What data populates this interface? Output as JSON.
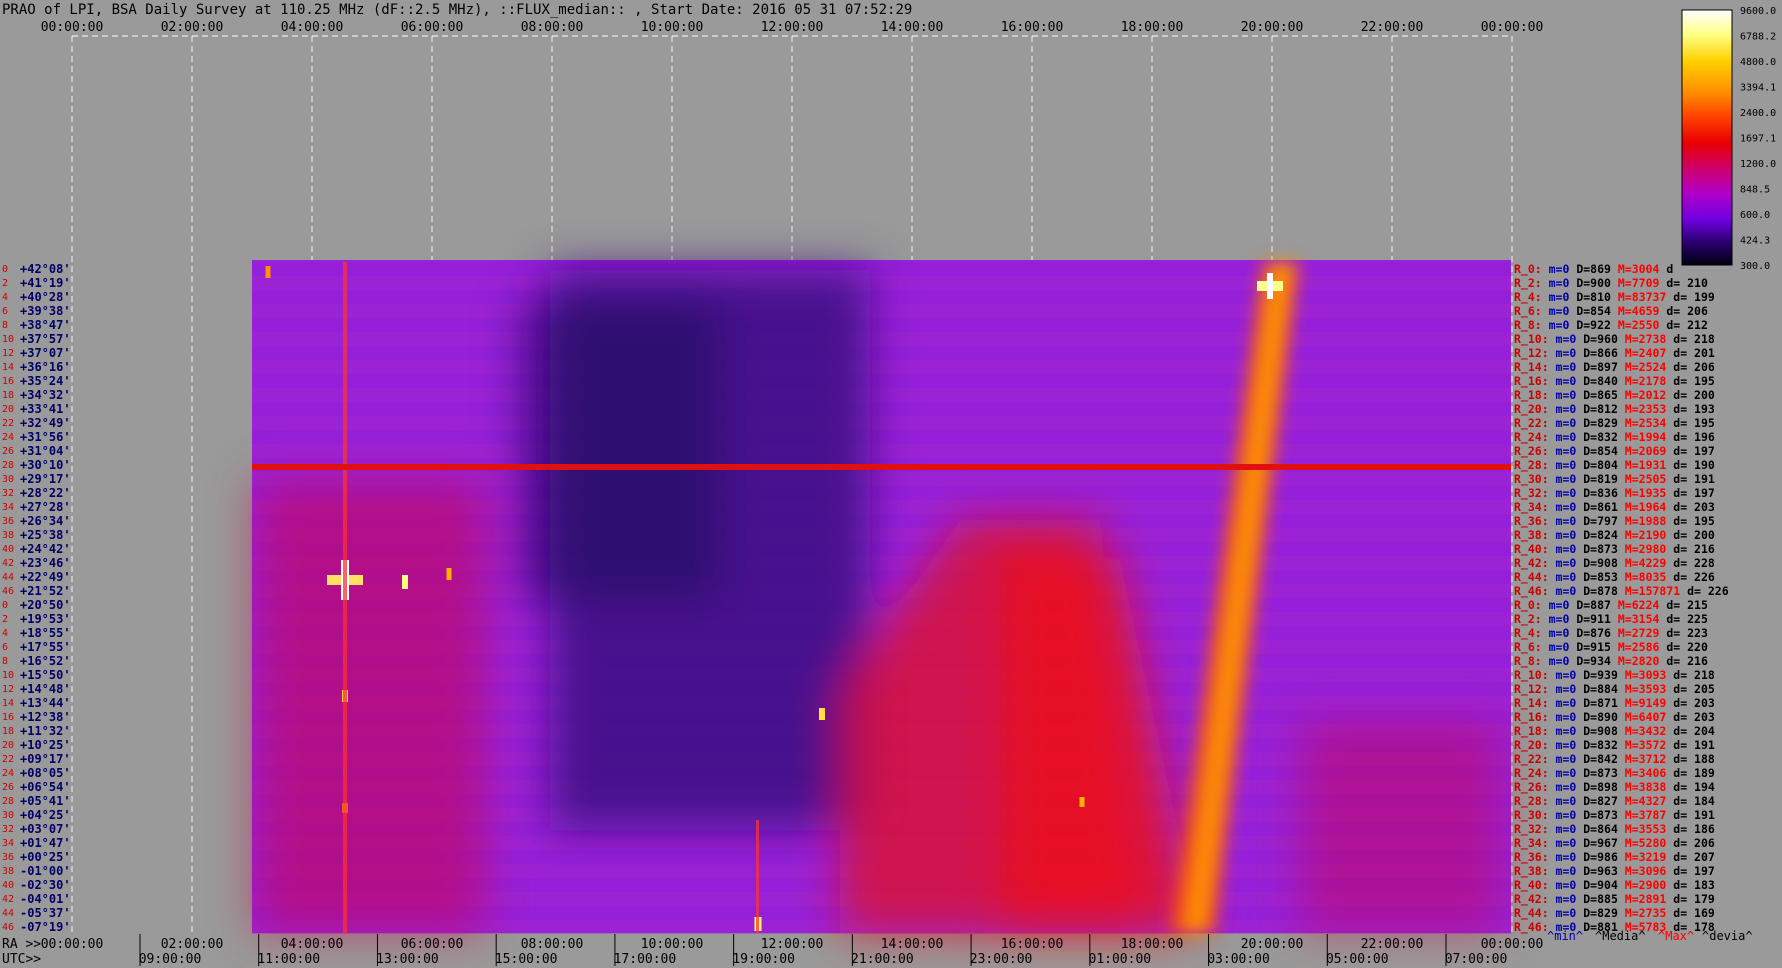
{
  "chart_data": {
    "type": "heatmap",
    "title": "PRAO of LPI, BSA Daily Survey at 110.25 MHz (dF::2.5 MHz), ::FLUX_median:: , Start Date: 2016 05 31 07:52:29",
    "top_axis_ticks": [
      "00:00:00",
      "02:00:00",
      "04:00:00",
      "06:00:00",
      "08:00:00",
      "10:00:00",
      "12:00:00",
      "14:00:00",
      "16:00:00",
      "18:00:00",
      "20:00:00",
      "22:00:00",
      "00:00:00"
    ],
    "ra_axis_label": "RA >>",
    "ra_axis_ticks": [
      "00:00:00",
      "02:00:00",
      "04:00:00",
      "06:00:00",
      "08:00:00",
      "10:00:00",
      "12:00:00",
      "14:00:00",
      "16:00:00",
      "18:00:00",
      "20:00:00",
      "22:00:00",
      "00:00:00"
    ],
    "utc_axis_label": "UTC>>",
    "utc_axis_ticks": [
      "09:00:00",
      "11:00:00",
      "13:00:00",
      "15:00:00",
      "17:00:00",
      "19:00:00",
      "21:00:00",
      "23:00:00",
      "01:00:00",
      "03:00:00",
      "05:00:00",
      "07:00:00"
    ],
    "beam_numbers": [
      0,
      2,
      4,
      6,
      8,
      10,
      12,
      14,
      16,
      18,
      20,
      22,
      24,
      26,
      28,
      30,
      32,
      34,
      36,
      38,
      40,
      42,
      44,
      46,
      0,
      2,
      4,
      6,
      8,
      10,
      12,
      14,
      16,
      18,
      20,
      22,
      24,
      26,
      28,
      30,
      32,
      34,
      36,
      38,
      40,
      42,
      44,
      46
    ],
    "declinations": [
      "+42°08'",
      "+41°19'",
      "+40°28'",
      "+39°38'",
      "+38°47'",
      "+37°57'",
      "+37°07'",
      "+36°16'",
      "+35°24'",
      "+34°32'",
      "+33°41'",
      "+32°49'",
      "+31°56'",
      "+31°04'",
      "+30°10'",
      "+29°17'",
      "+28°22'",
      "+27°28'",
      "+26°34'",
      "+25°38'",
      "+24°42'",
      "+23°46'",
      "+22°49'",
      "+21°52'",
      "+20°50'",
      "+19°53'",
      "+18°55'",
      "+17°55'",
      "+16°52'",
      "+15°50'",
      "+14°48'",
      "+13°44'",
      "+12°38'",
      "+11°32'",
      "+10°25'",
      "+09°17'",
      "+08°05'",
      "+06°54'",
      "+05°41'",
      "+04°25'",
      "+03°07'",
      "+01°47'",
      "+00°25'",
      "-01°00'",
      "-02°30'",
      "-04°01'",
      "-05°37'",
      "-07°19'"
    ],
    "beam_stats": [
      {
        "label": "R_0:",
        "min": "m=0",
        "median": "D=869",
        "max": "M=3004",
        "dev": "d"
      },
      {
        "label": "R_2:",
        "min": "m=0",
        "median": "D=900",
        "max": "M=7709",
        "dev": "d= 210"
      },
      {
        "label": "R_4:",
        "min": "m=0",
        "median": "D=810",
        "max": "M=83737",
        "dev": "d= 199"
      },
      {
        "label": "R_6:",
        "min": "m=0",
        "median": "D=854",
        "max": "M=4659",
        "dev": "d= 206"
      },
      {
        "label": "R_8:",
        "min": "m=0",
        "median": "D=922",
        "max": "M=2550",
        "dev": "d= 212"
      },
      {
        "label": "R_10:",
        "min": "m=0",
        "median": "D=960",
        "max": "M=2738",
        "dev": "d= 218"
      },
      {
        "label": "R_12:",
        "min": "m=0",
        "median": "D=866",
        "max": "M=2407",
        "dev": "d= 201"
      },
      {
        "label": "R_14:",
        "min": "m=0",
        "median": "D=897",
        "max": "M=2524",
        "dev": "d= 206"
      },
      {
        "label": "R_16:",
        "min": "m=0",
        "median": "D=840",
        "max": "M=2178",
        "dev": "d= 195"
      },
      {
        "label": "R_18:",
        "min": "m=0",
        "median": "D=865",
        "max": "M=2012",
        "dev": "d= 200"
      },
      {
        "label": "R_20:",
        "min": "m=0",
        "median": "D=812",
        "max": "M=2353",
        "dev": "d= 193"
      },
      {
        "label": "R_22:",
        "min": "m=0",
        "median": "D=829",
        "max": "M=2534",
        "dev": "d= 195"
      },
      {
        "label": "R_24:",
        "min": "m=0",
        "median": "D=832",
        "max": "M=1994",
        "dev": "d= 196"
      },
      {
        "label": "R_26:",
        "min": "m=0",
        "median": "D=854",
        "max": "M=2069",
        "dev": "d= 197"
      },
      {
        "label": "R_28:",
        "min": "m=0",
        "median": "D=804",
        "max": "M=1931",
        "dev": "d= 190"
      },
      {
        "label": "R_30:",
        "min": "m=0",
        "median": "D=819",
        "max": "M=2505",
        "dev": "d= 191"
      },
      {
        "label": "R_32:",
        "min": "m=0",
        "median": "D=836",
        "max": "M=1935",
        "dev": "d= 197"
      },
      {
        "label": "R_34:",
        "min": "m=0",
        "median": "D=861",
        "max": "M=1964",
        "dev": "d= 203"
      },
      {
        "label": "R_36:",
        "min": "m=0",
        "median": "D=797",
        "max": "M=1988",
        "dev": "d= 195"
      },
      {
        "label": "R_38:",
        "min": "m=0",
        "median": "D=824",
        "max": "M=2190",
        "dev": "d= 200"
      },
      {
        "label": "R_40:",
        "min": "m=0",
        "median": "D=873",
        "max": "M=2980",
        "dev": "d= 216"
      },
      {
        "label": "R_42:",
        "min": "m=0",
        "median": "D=908",
        "max": "M=4229",
        "dev": "d= 228"
      },
      {
        "label": "R_44:",
        "min": "m=0",
        "median": "D=853",
        "max": "M=8035",
        "dev": "d= 226"
      },
      {
        "label": "R_46:",
        "min": "m=0",
        "median": "D=878",
        "max": "M=157871",
        "dev": "d= 226"
      },
      {
        "label": "R_0:",
        "min": "m=0",
        "median": "D=887",
        "max": "M=6224",
        "dev": "d= 215"
      },
      {
        "label": "R_2:",
        "min": "m=0",
        "median": "D=911",
        "max": "M=3154",
        "dev": "d= 225"
      },
      {
        "label": "R_4:",
        "min": "m=0",
        "median": "D=876",
        "max": "M=2729",
        "dev": "d= 223"
      },
      {
        "label": "R_6:",
        "min": "m=0",
        "median": "D=915",
        "max": "M=2586",
        "dev": "d= 220"
      },
      {
        "label": "R_8:",
        "min": "m=0",
        "median": "D=934",
        "max": "M=2820",
        "dev": "d= 216"
      },
      {
        "label": "R_10:",
        "min": "m=0",
        "median": "D=939",
        "max": "M=3093",
        "dev": "d= 218"
      },
      {
        "label": "R_12:",
        "min": "m=0",
        "median": "D=884",
        "max": "M=3593",
        "dev": "d= 205"
      },
      {
        "label": "R_14:",
        "min": "m=0",
        "median": "D=871",
        "max": "M=9149",
        "dev": "d= 203"
      },
      {
        "label": "R_16:",
        "min": "m=0",
        "median": "D=890",
        "max": "M=6407",
        "dev": "d= 203"
      },
      {
        "label": "R_18:",
        "min": "m=0",
        "median": "D=908",
        "max": "M=3432",
        "dev": "d= 204"
      },
      {
        "label": "R_20:",
        "min": "m=0",
        "median": "D=832",
        "max": "M=3572",
        "dev": "d= 191"
      },
      {
        "label": "R_22:",
        "min": "m=0",
        "median": "D=842",
        "max": "M=3712",
        "dev": "d= 188"
      },
      {
        "label": "R_24:",
        "min": "m=0",
        "median": "D=873",
        "max": "M=3406",
        "dev": "d= 189"
      },
      {
        "label": "R_26:",
        "min": "m=0",
        "median": "D=898",
        "max": "M=3838",
        "dev": "d= 194"
      },
      {
        "label": "R_28:",
        "min": "m=0",
        "median": "D=827",
        "max": "M=4327",
        "dev": "d= 184"
      },
      {
        "label": "R_30:",
        "min": "m=0",
        "median": "D=873",
        "max": "M=3787",
        "dev": "d= 191"
      },
      {
        "label": "R_32:",
        "min": "m=0",
        "median": "D=864",
        "max": "M=3553",
        "dev": "d= 186"
      },
      {
        "label": "R_34:",
        "min": "m=0",
        "median": "D=967",
        "max": "M=5280",
        "dev": "d= 206"
      },
      {
        "label": "R_36:",
        "min": "m=0",
        "median": "D=986",
        "max": "M=3219",
        "dev": "d= 207"
      },
      {
        "label": "R_38:",
        "min": "m=0",
        "median": "D=963",
        "max": "M=3096",
        "dev": "d= 197"
      },
      {
        "label": "R_40:",
        "min": "m=0",
        "median": "D=904",
        "max": "M=2900",
        "dev": "d= 183"
      },
      {
        "label": "R_42:",
        "min": "m=0",
        "median": "D=885",
        "max": "M=2891",
        "dev": "d= 179"
      },
      {
        "label": "R_44:",
        "min": "m=0",
        "median": "D=829",
        "max": "M=2735",
        "dev": "d= 169"
      },
      {
        "label": "R_46:",
        "min": "m=0",
        "median": "D=881",
        "max": "M=5783",
        "dev": "d= 178"
      }
    ],
    "stats_legend": {
      "min": "^min^",
      "median": "^Media^",
      "max": "^Max^",
      "dev": "^devia^"
    },
    "colorbar": {
      "ticks": [
        "9600.0",
        "6788.2",
        "4800.0",
        "3394.1",
        "2400.0",
        "1697.1",
        "1200.0",
        "848.5",
        "600.0",
        "424.3",
        "300.0"
      ],
      "colors": [
        "#ffffff",
        "#ffff80",
        "#ffd000",
        "#ff9000",
        "#ff4000",
        "#e80000",
        "#d0006a",
        "#b000c8",
        "#7000e0",
        "#2a0070",
        "#000010"
      ]
    },
    "colors": {
      "background": "#9a9a9a",
      "grid": "#ffffff",
      "beam_label": "#cc0000",
      "dec_label": "#000066",
      "stat_min": "#0000aa",
      "stat_median": "#000000",
      "stat_max": "#ff0000",
      "stat_dev": "#000000"
    }
  }
}
